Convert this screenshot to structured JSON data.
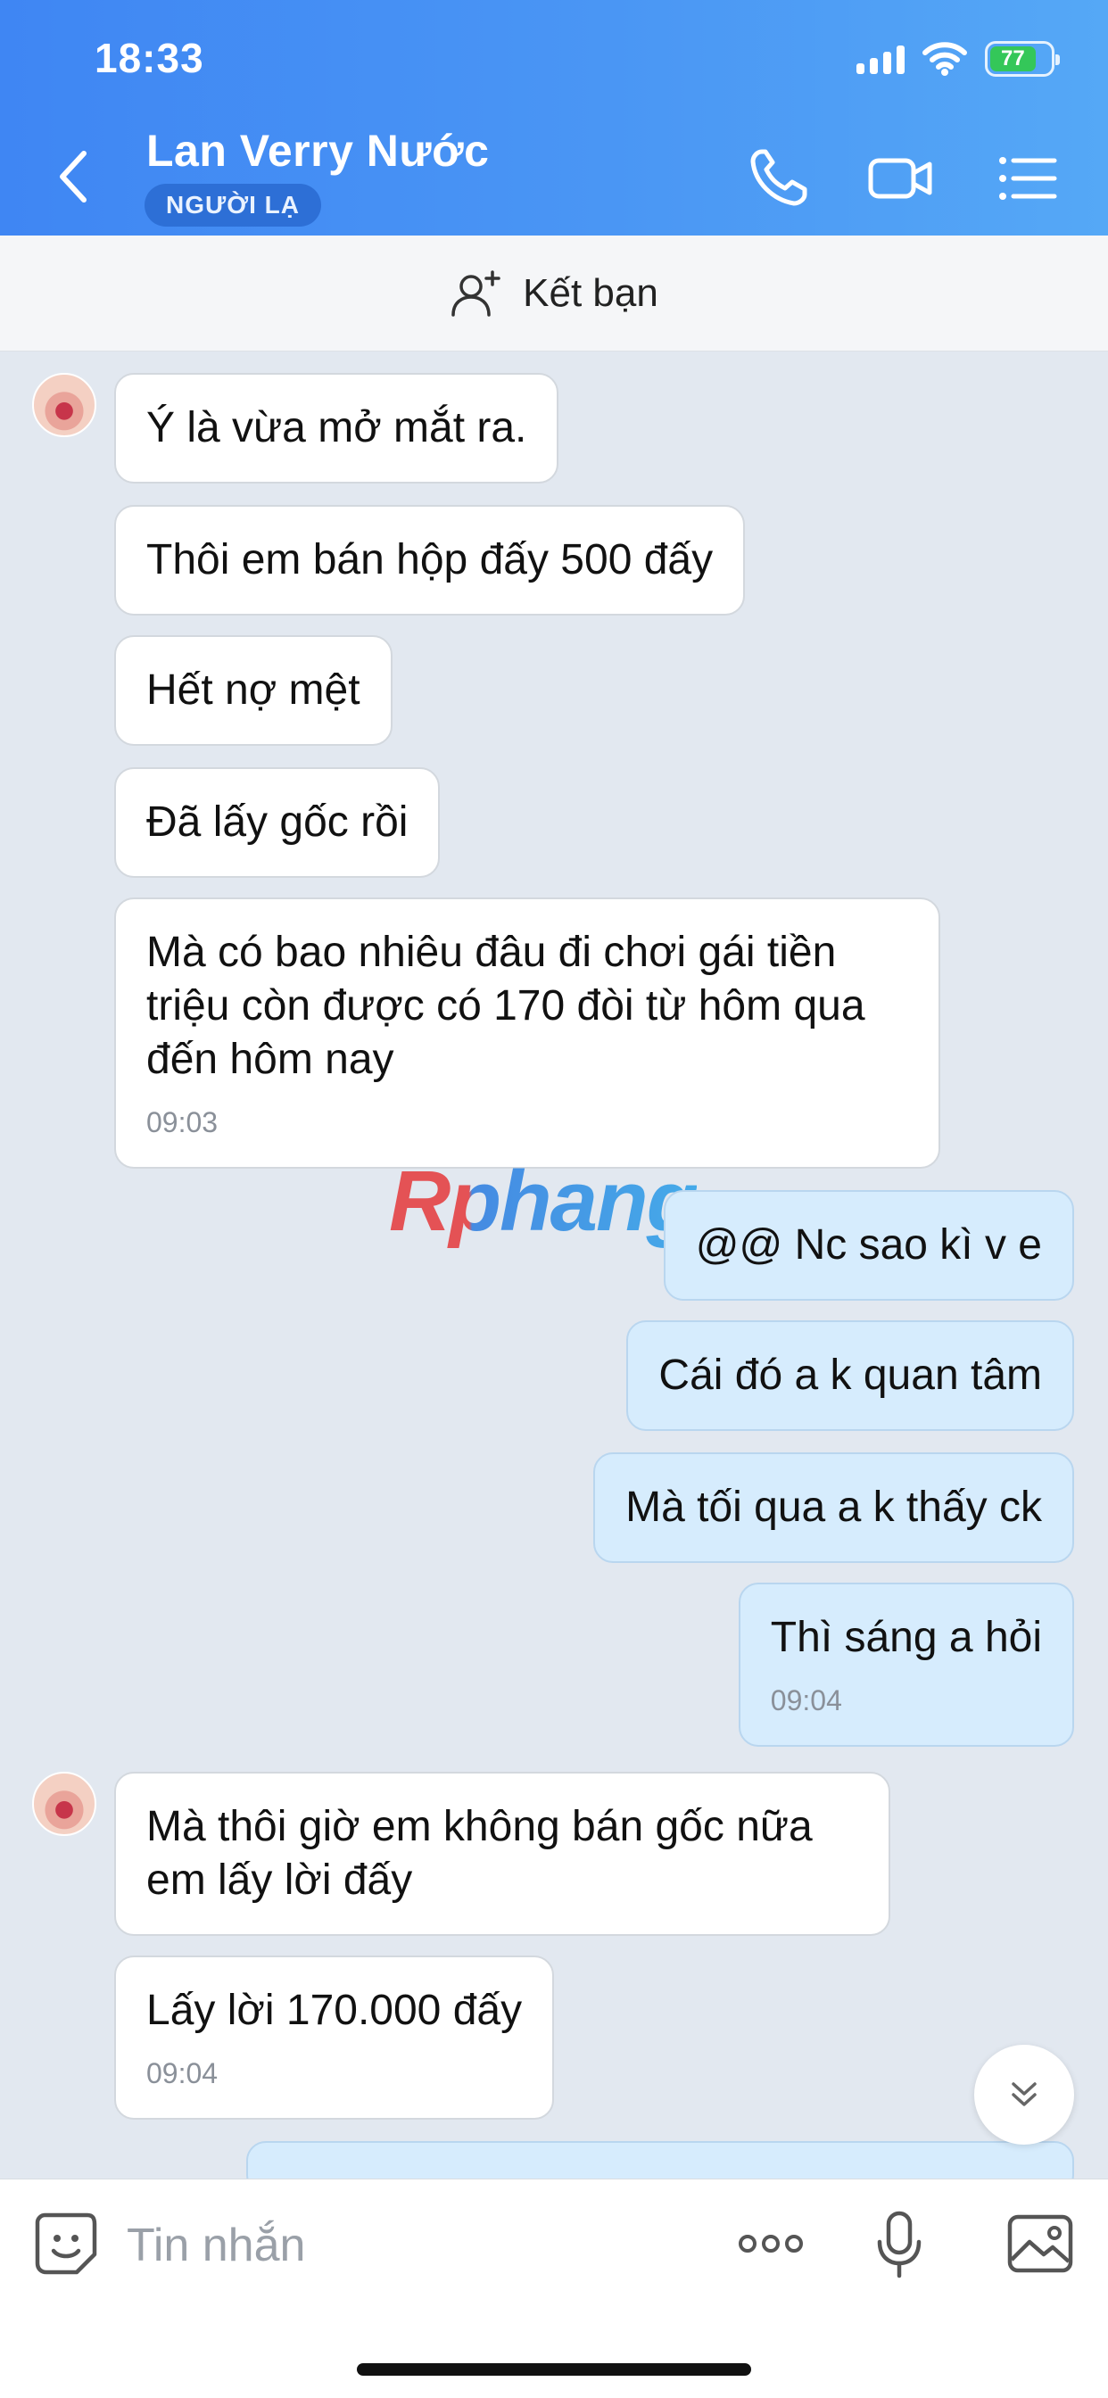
{
  "status_bar": {
    "time": "18:33",
    "battery": "77"
  },
  "header": {
    "contact_name": "Lan Verry Nước",
    "badge": "NGƯỜI LẠ",
    "icons": [
      "back-chevron-icon",
      "phone-icon",
      "video-call-icon",
      "menu-list-icon"
    ]
  },
  "friend_bar": {
    "label": "Kết bạn",
    "icon": "add-user-icon"
  },
  "watermark": "Rphang",
  "messages": [
    {
      "sender": "them",
      "text": "Ý là vừa mở mắt ra."
    },
    {
      "sender": "them",
      "text": "Thôi em bán hộp đấy 500 đấy"
    },
    {
      "sender": "them",
      "text": "Hết nợ mệt"
    },
    {
      "sender": "them",
      "text": "Đã lấy gốc rồi"
    },
    {
      "sender": "them",
      "lines": [
        "Mà có bao nhiêu đâu đi chơi gái tiền",
        "triệu còn được có 170 đòi từ hôm qua",
        "đến hôm nay"
      ],
      "time": "09:03"
    },
    {
      "sender": "me",
      "text": "@@ Nc sao kì v e"
    },
    {
      "sender": "me",
      "text": "Cái đó a k quan tâm"
    },
    {
      "sender": "me",
      "text": "Mà tối qua a k thấy ck"
    },
    {
      "sender": "me",
      "text": "Thì sáng a hỏi",
      "time": "09:04"
    },
    {
      "sender": "them",
      "lines": [
        "Mà thôi giờ em không bán gốc nữa",
        "em lấy lời đấy"
      ]
    },
    {
      "sender": "them",
      "text": "Lấy lời 170.000 đấy",
      "time": "09:04"
    }
  ],
  "composer": {
    "placeholder": "Tin nhắn",
    "icons": [
      "sticker-icon",
      "more-dots-icon",
      "microphone-icon",
      "image-icon"
    ]
  },
  "colors": {
    "header_start": "#3f86f3",
    "header_end": "#55a8f6",
    "my_bubble": "#d6ecfd",
    "their_bubble": "#ffffff",
    "chat_bg": "#e2e8f0"
  }
}
